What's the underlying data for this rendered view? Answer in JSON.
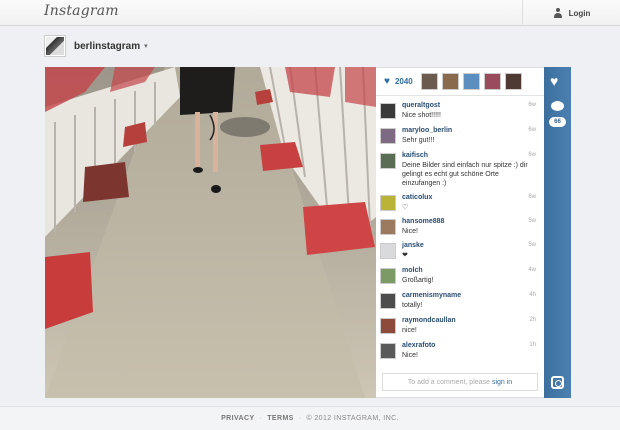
{
  "header": {
    "logo": "Instagram",
    "login_label": "Login"
  },
  "profile": {
    "username": "berlinstagram",
    "caret": "▾"
  },
  "post": {
    "like_count": "2040",
    "comment_count": "66",
    "likers": [
      "#6b5a4e",
      "#8a6a4c",
      "#5c8fbf",
      "#9a4b5c",
      "#4e3a32"
    ],
    "comments": [
      {
        "user": "queraltgost",
        "text": "Nice shot!!!!!",
        "time": "6w",
        "avatar": "#3a3a3a"
      },
      {
        "user": "maryloo_berlin",
        "text": "Sehr gut!!!",
        "time": "6w",
        "avatar": "#7f6a83"
      },
      {
        "user": "kaifisch",
        "text": "Deine Bilder sind einfach nur spitze :) dir gelingt es echt gut schöne Orte einzufangen :)",
        "time": "6w",
        "avatar": "#5b6d55"
      },
      {
        "user": "caticolux",
        "text": "♡",
        "time": "6w",
        "avatar": "#b9b337"
      },
      {
        "user": "hansome888",
        "text": "Nice!",
        "time": "5w",
        "avatar": "#9c7a5f"
      },
      {
        "user": "janske",
        "text": "❤",
        "time": "5w",
        "avatar": "#d9dadc"
      },
      {
        "user": "molch",
        "text": "Großartig!",
        "time": "4w",
        "avatar": "#7b9a66"
      },
      {
        "user": "carmenismyname",
        "text": "totally!",
        "time": "4h",
        "avatar": "#4d4d4d"
      },
      {
        "user": "raymondcaullan",
        "text": "nice!",
        "time": "2h",
        "avatar": "#8c4a3a"
      },
      {
        "user": "alexrafoto",
        "text": "Nice!",
        "time": "1h",
        "avatar": "#5a5a5a"
      }
    ],
    "add_comment_placeholder": "To add a comment, please",
    "sign_in_label": "sign in"
  },
  "footer": {
    "privacy": "PRIVACY",
    "terms": "TERMS",
    "copyright": "© 2012 INSTAGRAM, INC."
  },
  "colors": {
    "accent": "#2f6ea5",
    "strip": "#3c6f9e"
  }
}
